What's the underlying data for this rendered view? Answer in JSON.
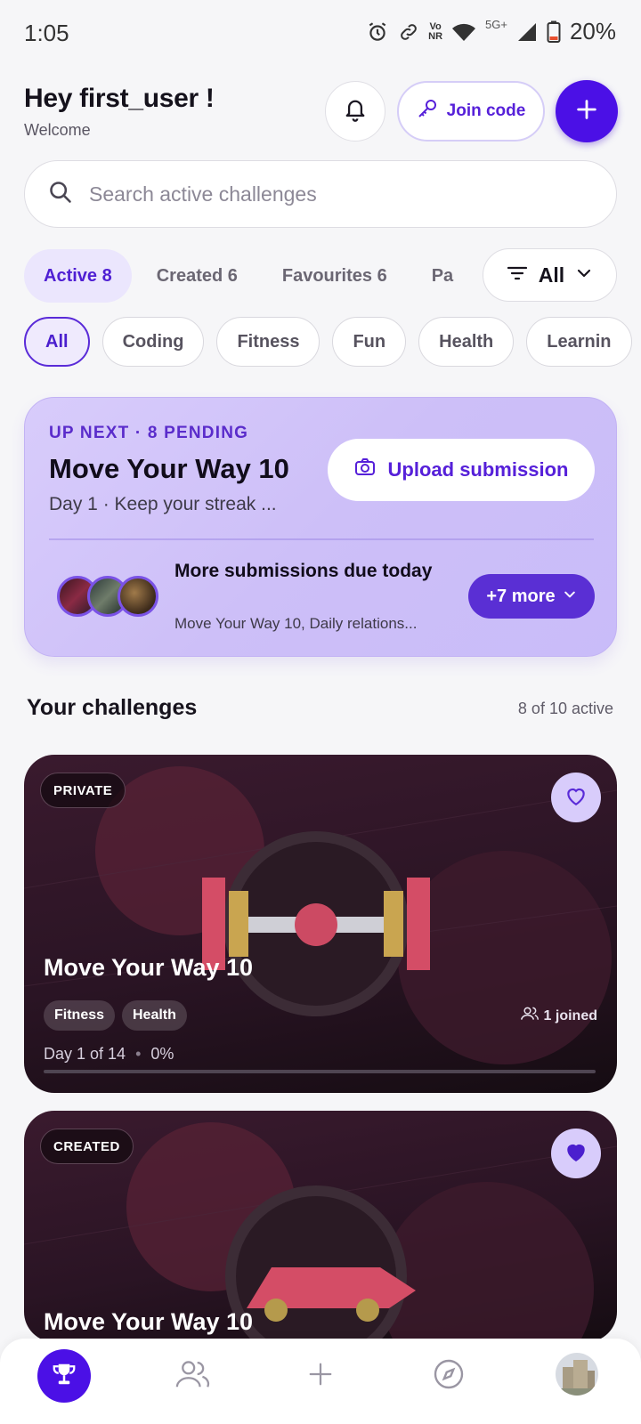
{
  "status_bar": {
    "time": "1:05",
    "network_label_top": "Vo",
    "network_label_bottom": "NR",
    "mobile_label": "5G+",
    "battery": "20%"
  },
  "header": {
    "greeting": "Hey first_user !",
    "subtitle": "Welcome",
    "join_code_label": "Join code"
  },
  "search": {
    "placeholder": "Search active challenges"
  },
  "tabs": [
    {
      "label": "Active 8",
      "active": true
    },
    {
      "label": "Created 6",
      "active": false
    },
    {
      "label": "Favourites 6",
      "active": false
    },
    {
      "label": "Pa",
      "active": false
    }
  ],
  "filter": {
    "label": "All"
  },
  "chips": [
    {
      "label": "All",
      "active": true
    },
    {
      "label": "Coding",
      "active": false
    },
    {
      "label": "Fitness",
      "active": false
    },
    {
      "label": "Fun",
      "active": false
    },
    {
      "label": "Health",
      "active": false
    },
    {
      "label": "Learnin",
      "active": false
    }
  ],
  "up_next": {
    "eyebrow": "UP NEXT · 8 PENDING",
    "title": "Move Your Way 10",
    "subtitle": "Day 1 · Keep your streak ...",
    "upload_label": "Upload submission",
    "more_title": "More submissions due today",
    "more_subtitle": "Move Your Way 10, Daily relations...",
    "more_button": "+7 more"
  },
  "section": {
    "title": "Your challenges",
    "count": "8 of 10 active"
  },
  "challenges": [
    {
      "badge": "PRIVATE",
      "favourite": false,
      "title": "Move Your Way 10",
      "tags": [
        "Fitness",
        "Health"
      ],
      "joined": "1 joined",
      "day_text": "Day 1 of 14",
      "percent_text": "0%",
      "progress": 0
    },
    {
      "badge": "CREATED",
      "favourite": true,
      "title": "Move Your Way 10"
    }
  ],
  "colors": {
    "accent": "#4b10e6",
    "accent_light": "#ebe6fd",
    "card_dark": "#2a1424"
  }
}
